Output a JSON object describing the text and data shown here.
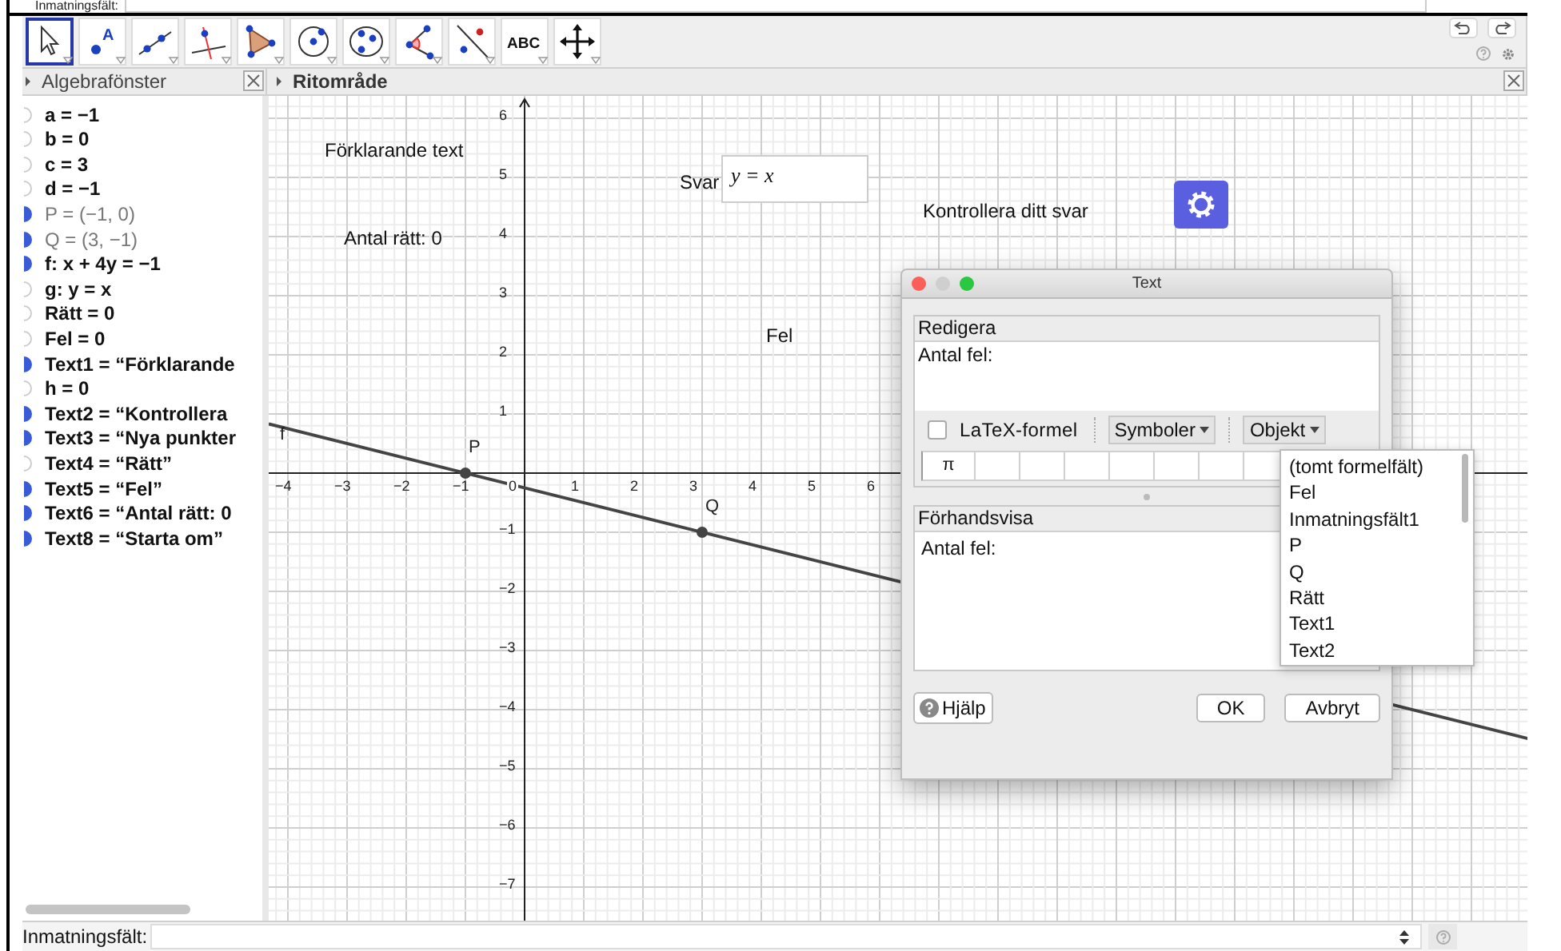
{
  "top_bar": {
    "label": "Inmatningsfält:"
  },
  "toolbar": {
    "tools": [
      {
        "kind": "move",
        "selected": true
      },
      {
        "kind": "point",
        "glyph": "A",
        "selected": false
      },
      {
        "kind": "line",
        "selected": false
      },
      {
        "kind": "perpendicular",
        "selected": false
      },
      {
        "kind": "polygon",
        "selected": false
      },
      {
        "kind": "circle",
        "selected": false
      },
      {
        "kind": "conic",
        "selected": false
      },
      {
        "kind": "angle",
        "selected": false
      },
      {
        "kind": "reflect",
        "selected": false
      },
      {
        "kind": "text",
        "glyph": "ABC",
        "selected": false
      },
      {
        "kind": "pan",
        "selected": false
      }
    ]
  },
  "algebra_view": {
    "title": "Algebrafönster",
    "items": [
      {
        "text": "a = −1",
        "visible": false,
        "dimmed": false
      },
      {
        "text": "b = 0",
        "visible": false,
        "dimmed": false
      },
      {
        "text": "c = 3",
        "visible": false,
        "dimmed": false
      },
      {
        "text": "d = −1",
        "visible": false,
        "dimmed": false
      },
      {
        "text": "P = (−1, 0)",
        "visible": true,
        "dimmed": true
      },
      {
        "text": "Q = (3, −1)",
        "visible": true,
        "dimmed": true
      },
      {
        "text": "f: x + 4y = −1",
        "visible": true,
        "dimmed": false
      },
      {
        "text": "g: y = x",
        "visible": false,
        "dimmed": false
      },
      {
        "text": "Rätt = 0",
        "visible": false,
        "dimmed": false
      },
      {
        "text": "Fel = 0",
        "visible": false,
        "dimmed": false
      },
      {
        "text": "Text1 = “Förklarande",
        "visible": true,
        "dimmed": false
      },
      {
        "text": "h = 0",
        "visible": false,
        "dimmed": false
      },
      {
        "text": "Text2 = “Kontrollera",
        "visible": true,
        "dimmed": false
      },
      {
        "text": "Text3 = “Nya punkter",
        "visible": true,
        "dimmed": false
      },
      {
        "text": "Text4 = “Rätt”",
        "visible": false,
        "dimmed": false
      },
      {
        "text": "Text5 = “Fel”",
        "visible": true,
        "dimmed": false
      },
      {
        "text": "Text6 = “Antal rätt: 0",
        "visible": true,
        "dimmed": false
      },
      {
        "text": "Text8 = “Starta om”",
        "visible": true,
        "dimmed": false
      }
    ]
  },
  "graphics_view": {
    "title": "Ritområde",
    "x_ticks": [
      "−4",
      "−3",
      "−2",
      "−1",
      "0",
      "1",
      "2",
      "3",
      "4",
      "5",
      "6"
    ],
    "y_ticks": [
      "6",
      "5",
      "4",
      "3",
      "2",
      "1",
      "−1",
      "−2",
      "−3",
      "−4",
      "−5",
      "−6",
      "−7"
    ],
    "texts": [
      "Förklarande text",
      "Antal rätt: 0",
      "Kontrollera ditt svar",
      "Fel"
    ],
    "answer": {
      "label": "Svar",
      "value": "y = x"
    },
    "line_label": "f",
    "points": [
      {
        "label": "P"
      },
      {
        "label": "Q"
      }
    ]
  },
  "dialog": {
    "title": "Text",
    "edit_header": "Redigera",
    "edit_text": "Antal fel:",
    "latex": {
      "label": "LaTeX-formel",
      "checked": false
    },
    "symbols_button": "Symboler",
    "objects_button": "Objekt",
    "symbol_cells": [
      "π",
      "",
      "",
      "",
      "",
      "",
      "",
      ""
    ],
    "preview_header": "Förhandsvisa",
    "preview_text": "Antal fel:",
    "help_button": "Hjälp",
    "ok_button": "OK",
    "cancel_button": "Avbryt",
    "menu": [
      "(tomt formelfält)",
      "Fel",
      "Inmatningsfält1",
      "P",
      "Q",
      "Rätt",
      "Text1",
      "Text2"
    ]
  },
  "input_bar": {
    "label": "Inmatningsfält:"
  }
}
